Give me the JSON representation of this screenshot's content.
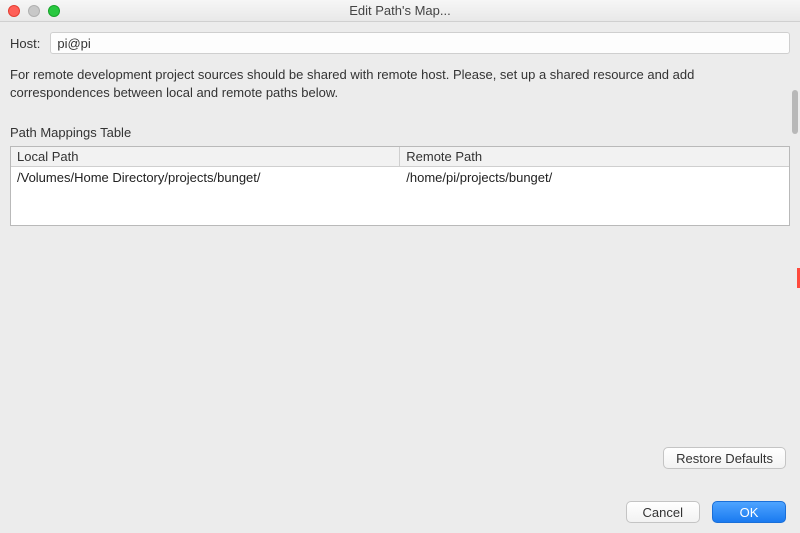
{
  "window": {
    "title": "Edit Path's Map..."
  },
  "host": {
    "label": "Host:",
    "value": "pi@pi"
  },
  "description": "For remote development project sources should be shared with remote host. Please, set up a shared resource and add correspondences between local and remote paths below.",
  "mappings": {
    "section_label": "Path Mappings Table",
    "columns": {
      "local": "Local Path",
      "remote": "Remote Path"
    },
    "rows": [
      {
        "local": "/Volumes/Home Directory/projects/bunget/",
        "remote": "/home/pi/projects/bunget/"
      }
    ]
  },
  "buttons": {
    "restore_defaults": "Restore Defaults",
    "cancel": "Cancel",
    "ok": "OK"
  }
}
